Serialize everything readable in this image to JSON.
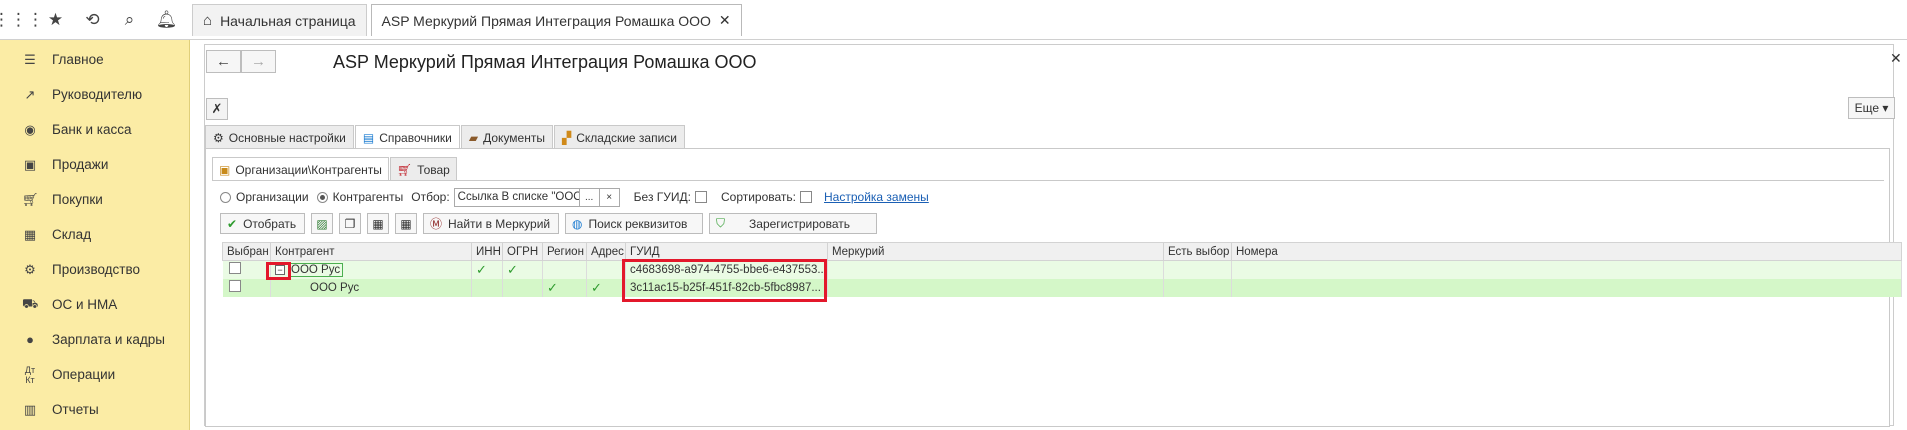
{
  "topbar": {
    "icons": [
      "apps-grid-icon",
      "star-icon",
      "history-icon",
      "search-icon",
      "bell-icon"
    ],
    "tabs": [
      {
        "label": "Начальная страница",
        "active": false
      },
      {
        "label": "ASP Меркурий Прямая Интеграция Ромашка ООО",
        "active": true
      }
    ]
  },
  "sidebar": {
    "items": [
      {
        "label": "Главное",
        "icon": "menu-lines-icon"
      },
      {
        "label": "Руководителю",
        "icon": "trend-icon"
      },
      {
        "label": "Банк и касса",
        "icon": "coin-icon"
      },
      {
        "label": "Продажи",
        "icon": "bag-icon"
      },
      {
        "label": "Покупки",
        "icon": "cart-icon"
      },
      {
        "label": "Склад",
        "icon": "warehouse-icon"
      },
      {
        "label": "Производство",
        "icon": "factory-icon"
      },
      {
        "label": "ОС и НМА",
        "icon": "truck-icon"
      },
      {
        "label": "Зарплата и кадры",
        "icon": "person-icon"
      },
      {
        "label": "Операции",
        "icon": "dt-kt-icon"
      },
      {
        "label": "Отчеты",
        "icon": "bar-chart-icon"
      }
    ]
  },
  "form": {
    "title": "ASP Меркурий Прямая Интеграция Ромашка ООО",
    "more_label": "Еще ▾",
    "tabs": [
      {
        "label": "Основные настройки",
        "icon": "gear-icon"
      },
      {
        "label": "Справочники",
        "icon": "directory-icon"
      },
      {
        "label": "Документы",
        "icon": "briefcase-icon"
      },
      {
        "label": "Складские записи",
        "icon": "blocks-icon"
      }
    ],
    "subtabs": [
      {
        "label": "Организации\\Контрагенты",
        "icon": "org-icon"
      },
      {
        "label": "Товар",
        "icon": "cart-red-icon"
      }
    ]
  },
  "filters": {
    "radio_org": "Организации",
    "radio_contr": "Контрагенты",
    "otbor_label": "Отбор:",
    "otbor_value": "Ссылка В списке \"ООО",
    "more_btn": "...",
    "clear_btn": "×",
    "no_guid": "Без ГУИД:",
    "sort": "Сортировать:",
    "replace_link": "Настройка замены"
  },
  "actions": {
    "select": "Отобрать",
    "find_mercury": "Найти в Меркурий",
    "find_req": "Поиск реквизитов",
    "register": "Зарегистрировать"
  },
  "table": {
    "headers": [
      "Выбран",
      "Контрагент",
      "ИНН",
      "ОГРН",
      "Регион",
      "Адрес",
      "ГУИД",
      "Меркурий",
      "Есть выбор",
      "Номера"
    ],
    "rows": [
      {
        "name": "ООО Рус",
        "inn": true,
        "ogrn": true,
        "region": true,
        "address": false,
        "guid": "c4683698-a974-4755-bbe6-e437553..."
      },
      {
        "name": "ООО Рус",
        "inn": false,
        "ogrn": false,
        "region": true,
        "address": true,
        "guid": "3c11ac15-b25f-451f-82cb-5fbc8987..."
      }
    ]
  }
}
